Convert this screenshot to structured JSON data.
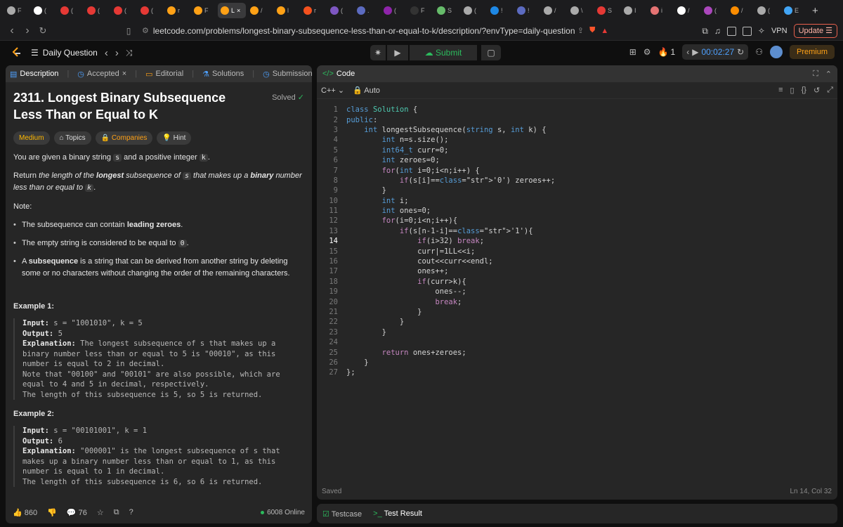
{
  "browser": {
    "tabs": [
      {
        "title": "F",
        "color": "#aaa"
      },
      {
        "title": "(",
        "color": "#fff"
      },
      {
        "title": "(",
        "color": "#e53935"
      },
      {
        "title": "(",
        "color": "#e53935"
      },
      {
        "title": "(",
        "color": "#e53935"
      },
      {
        "title": "(",
        "color": "#e53935"
      },
      {
        "title": "r",
        "color": "#ffa116"
      },
      {
        "title": "F",
        "color": "#ffa116"
      },
      {
        "title": "L",
        "color": "#ffa116",
        "active": true
      },
      {
        "title": "/",
        "color": "#ffa116"
      },
      {
        "title": "l",
        "color": "#ffa116"
      },
      {
        "title": "r",
        "color": "#f4511e"
      },
      {
        "title": "(",
        "color": "#7e57c2"
      },
      {
        "title": ".",
        "color": "#5c6bc0"
      },
      {
        "title": "(",
        "color": "#8e24aa"
      },
      {
        "title": "F",
        "color": "#333"
      },
      {
        "title": "S",
        "color": "#66bb6a"
      },
      {
        "title": "(",
        "color": "#aaa"
      },
      {
        "title": "!",
        "color": "#1e88e5"
      },
      {
        "title": "!",
        "color": "#5c6bc0"
      },
      {
        "title": "/",
        "color": "#aaa"
      },
      {
        "title": "\\",
        "color": "#aaa"
      },
      {
        "title": "S",
        "color": "#e53935"
      },
      {
        "title": "I",
        "color": "#aaa"
      },
      {
        "title": "i",
        "color": "#e57373"
      },
      {
        "title": "/",
        "color": "#fff"
      },
      {
        "title": "(",
        "color": "#ab47bc"
      },
      {
        "title": "/",
        "color": "#fb8c00"
      },
      {
        "title": "(",
        "color": "#aaa"
      },
      {
        "title": "E",
        "color": "#42a5f5"
      }
    ],
    "url": "leetcode.com/problems/longest-binary-subsequence-less-than-or-equal-to-k/description/?envType=daily-question&envId=2...",
    "vpn": "VPN",
    "update": "Update"
  },
  "header": {
    "daily": "Daily Question",
    "submit": "Submit",
    "streak": "1",
    "timer": "00:02:27",
    "premium": "Premium"
  },
  "left": {
    "tabs": [
      "Description",
      "Accepted",
      "Editorial",
      "Solutions",
      "Submissions"
    ],
    "title": "2311. Longest Binary Subsequence Less Than or Equal to K",
    "solved": "Solved",
    "difficulty": "Medium",
    "topics": "Topics",
    "companies": "Companies",
    "hint": "Hint",
    "p1a": "You are given a binary string ",
    "p1s": "s",
    "p1b": " and a positive integer ",
    "p1k": "k",
    "p1c": ".",
    "p2a": "Return ",
    "p2b": "the length of the ",
    "p2c": "longest",
    "p2d": " subsequence of ",
    "p2s": "s",
    "p2e": " that makes up a ",
    "p2f": "binary",
    "p2g": " number less than or equal to ",
    "p2k": "k",
    "p2h": ".",
    "note": "Note:",
    "b1a": "The subsequence can contain ",
    "b1b": "leading zeroes",
    "b2a": "The empty string is considered to be equal to ",
    "b2b": "0",
    "b3a": "A ",
    "b3b": "subsequence",
    "b3c": " is a string that can be derived from another string by deleting some or no characters without changing the order of the remaining characters.",
    "ex1": "Example 1:",
    "ex1in": "Input:",
    "ex1inv": " s = \"1001010\", k = 5",
    "ex1out": "Output:",
    "ex1outv": " 5",
    "ex1exp": "Explanation:",
    "ex1expv": " The longest subsequence of s that makes up a binary number less than or equal to 5 is \"00010\", as this number is equal to 2 in decimal.\nNote that \"00100\" and \"00101\" are also possible, which are equal to 4 and 5 in decimal, respectively.\nThe length of this subsequence is 5, so 5 is returned.",
    "ex2": "Example 2:",
    "ex2in": "Input:",
    "ex2inv": " s = \"00101001\", k = 1",
    "ex2out": "Output:",
    "ex2outv": " 6",
    "ex2exp": "Explanation:",
    "ex2expv": " \"000001\" is the longest subsequence of s that makes up a binary number less than or equal to 1, as this number is equal to 1 in decimal.\nThe length of this subsequence is 6, so 6 is returned.",
    "likes": "860",
    "comments": "76",
    "online": "6008 Online"
  },
  "code": {
    "title": "Code",
    "lang": "C++",
    "mode": "Auto",
    "saved": "Saved",
    "pos": "Ln 14, Col 32",
    "lines": [
      "class Solution {",
      "public:",
      "    int longestSubsequence(string s, int k) {",
      "        int n=s.size();",
      "        int64_t curr=0;",
      "        int zeroes=0;",
      "        for(int i=0;i<n;i++) {",
      "            if(s[i]=='0') zeroes++;",
      "        }",
      "        int i;",
      "        int ones=0;",
      "        for(i=0;i<n;i++){",
      "            if(s[n-1-i]=='1'){",
      "                if(i>32) break;",
      "                curr|=1LL<<i;",
      "                cout<<curr<<endl;",
      "                ones++;",
      "                if(curr>k){",
      "                    ones--;",
      "                    break;",
      "                }",
      "            }",
      "        }",
      "",
      "        return ones+zeroes;",
      "    }",
      "};"
    ]
  },
  "bottom": {
    "testcase": "Testcase",
    "result": "Test Result"
  }
}
